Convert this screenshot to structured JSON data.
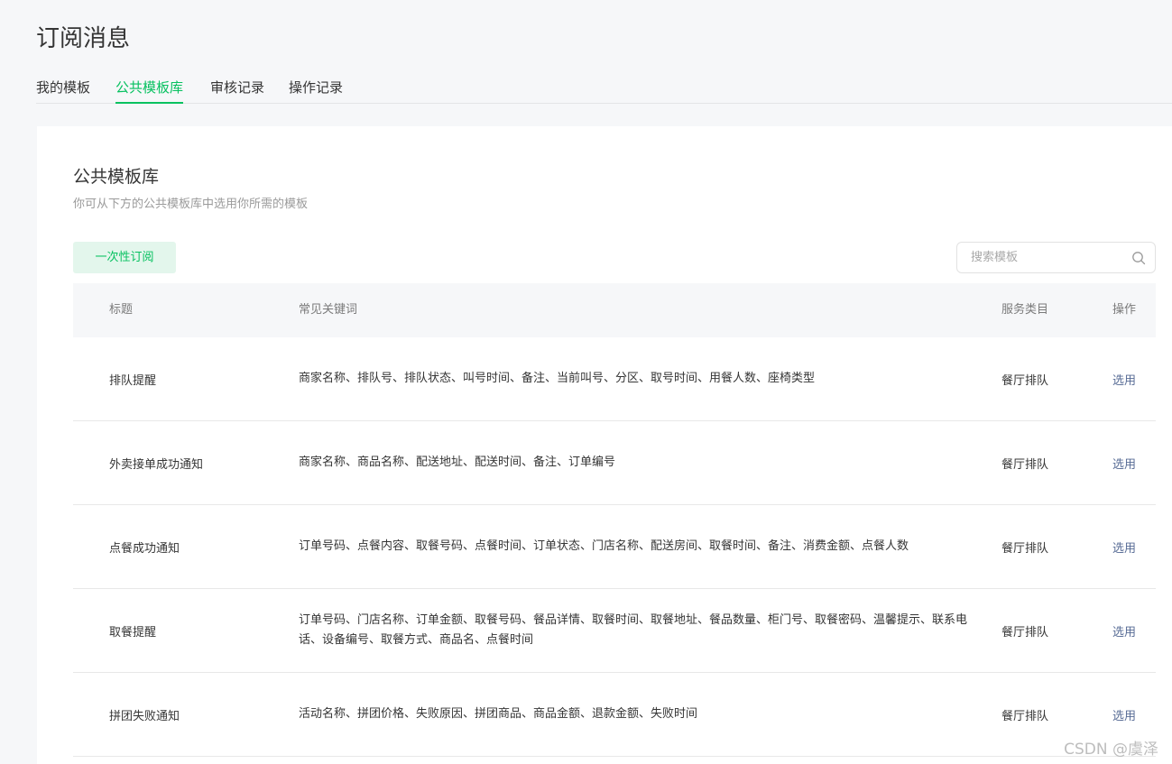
{
  "header": {
    "title": "订阅消息"
  },
  "tabs": [
    {
      "label": "我的模板",
      "active": false
    },
    {
      "label": "公共模板库",
      "active": true
    },
    {
      "label": "审核记录",
      "active": false
    },
    {
      "label": "操作记录",
      "active": false
    }
  ],
  "library": {
    "title": "公共模板库",
    "description": "你可从下方的公共模板库中选用你所需的模板",
    "type_button": "一次性订阅",
    "search": {
      "placeholder": "搜索模板",
      "value": ""
    }
  },
  "table": {
    "columns": {
      "title": "标题",
      "keywords": "常见关键词",
      "category": "服务类目",
      "action": "操作"
    },
    "rows": [
      {
        "title": "排队提醒",
        "keywords": "商家名称、排队号、排队状态、叫号时间、备注、当前叫号、分区、取号时间、用餐人数、座椅类型",
        "category": "餐厅排队",
        "action": "选用"
      },
      {
        "title": "外卖接单成功通知",
        "keywords": "商家名称、商品名称、配送地址、配送时间、备注、订单编号",
        "category": "餐厅排队",
        "action": "选用"
      },
      {
        "title": "点餐成功通知",
        "keywords": "订单号码、点餐内容、取餐号码、点餐时间、订单状态、门店名称、配送房间、取餐时间、备注、消费金额、点餐人数",
        "category": "餐厅排队",
        "action": "选用"
      },
      {
        "title": "取餐提醒",
        "keywords": "订单号码、门店名称、订单金额、取餐号码、餐品详情、取餐时间、取餐地址、餐品数量、柜门号、取餐密码、温馨提示、联系电话、设备编号、取餐方式、商品名、点餐时间",
        "category": "餐厅排队",
        "action": "选用"
      },
      {
        "title": "拼团失败通知",
        "keywords": "活动名称、拼团价格、失败原因、拼团商品、商品金额、退款金额、失败时间",
        "category": "餐厅排队",
        "action": "选用"
      }
    ]
  },
  "watermark": "CSDN @虞泽",
  "colors": {
    "accent": "#07c160",
    "link": "#576b95",
    "page_bg": "#f6f7f9",
    "button_bg": "#e3f6ec"
  }
}
